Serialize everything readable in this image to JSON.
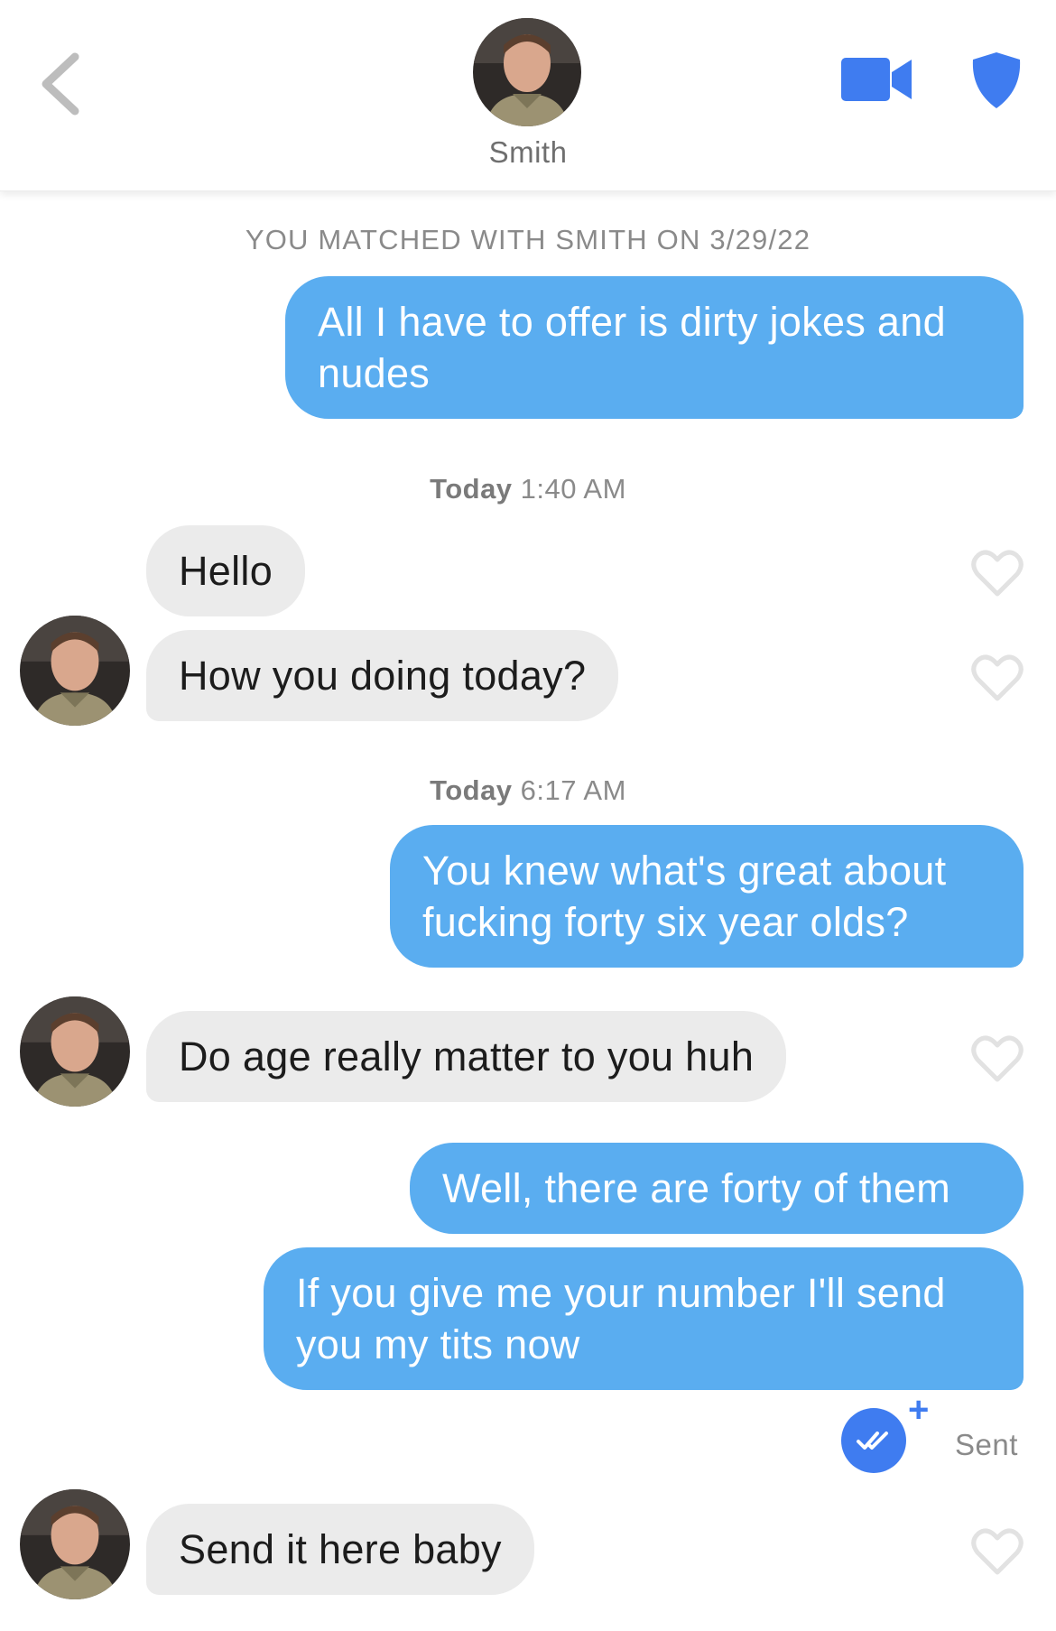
{
  "header": {
    "name": "Smith",
    "brand_color": "#3f7cf0"
  },
  "chat": {
    "match_notice": "YOU MATCHED WITH SMITH ON 3/29/22",
    "timestamps": [
      {
        "day": "Today",
        "time": "1:40 AM"
      },
      {
        "day": "Today",
        "time": "6:17 AM"
      }
    ],
    "messages": [
      {
        "from": "me",
        "text": "All I have to offer is dirty jokes and nudes"
      },
      {
        "from": "them",
        "text": "Hello"
      },
      {
        "from": "them",
        "text": "How you doing today?"
      },
      {
        "from": "me",
        "text": "You knew what's great about fucking forty six year olds?"
      },
      {
        "from": "them",
        "text": "Do age really matter to you huh"
      },
      {
        "from": "me",
        "text": "Well, there are forty of them"
      },
      {
        "from": "me",
        "text": "If you give me your number I'll send you my tits now"
      },
      {
        "from": "them",
        "text": "Send it here baby"
      }
    ],
    "status": {
      "read_receipt_icon": "double-check-icon",
      "plus": "+",
      "sent": "Sent"
    }
  },
  "colors": {
    "outgoing_bubble": "#5aadf0",
    "incoming_bubble": "#ebebeb",
    "accent": "#3f7cf0"
  }
}
